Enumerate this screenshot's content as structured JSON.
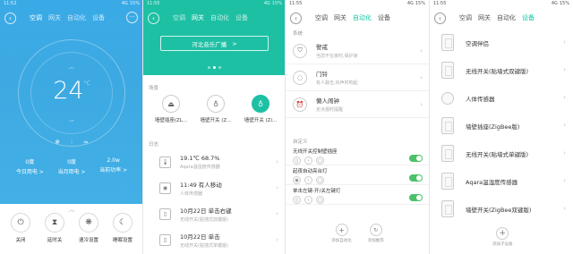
{
  "tabs": [
    "空调",
    "网关",
    "自动化",
    "设备"
  ],
  "status": {
    "p1_time": "11:52",
    "p2_time": "11:55",
    "p3_time": "11:55",
    "p4_time": "11:55",
    "signal": "4G",
    "battery": "15%"
  },
  "ac": {
    "temp": "24",
    "unit": "°C",
    "stats": [
      {
        "value": "0度",
        "label": "今日用电 >"
      },
      {
        "value": "0度",
        "label": "当月用电 >"
      },
      {
        "value": "2.0w",
        "label": "当前功率 >"
      }
    ],
    "controls": [
      {
        "icon": "⏻",
        "label": "关闭"
      },
      {
        "icon": "⧗",
        "label": "延时关"
      },
      {
        "icon": "❋",
        "label": "速冷设置"
      },
      {
        "icon": "☾",
        "label": "睡眠设置"
      }
    ]
  },
  "gateway": {
    "radio": "河北音乐广播",
    "radio_arrow": ">",
    "scene_title": "场景",
    "scenes": [
      "墙壁插座(ZL...",
      "墙壁开关 (Z...",
      "墙壁开关 (Zi..."
    ],
    "log_title": "日志",
    "logs": [
      {
        "main": "19.1℃  68.7%",
        "sub": "Aqara温湿度传感器"
      },
      {
        "main": "11:49  有人移动",
        "sub": "人体传感器"
      },
      {
        "main": "10月22日  单击右键",
        "sub": "无线开关(贴墙式双键版)"
      },
      {
        "main": "10月22日  单击",
        "sub": "无线开关(贴墙式单键版)"
      }
    ]
  },
  "automation": {
    "system_title": "系统",
    "items": [
      {
        "main": "警戒",
        "sub": "当您不在家时,保护家"
      },
      {
        "main": "门铃",
        "sub": "有人敲击,铃声时响起"
      },
      {
        "main": "懒人闹钟",
        "sub": "定点报时提醒"
      }
    ],
    "custom_title": "自定义",
    "custom": [
      {
        "main": "无线开关控制壁插座"
      },
      {
        "main": "起夜自动亮台灯"
      },
      {
        "main": "单击左键-开/关左键灯"
      }
    ],
    "actions": [
      {
        "icon": "+",
        "label": "添加自动化"
      },
      {
        "icon": "↻",
        "label": "添加推荐"
      }
    ]
  },
  "devices": {
    "items": [
      "空调伴侣",
      "无线开关(贴墙式双键版)",
      "人体传感器",
      "墙壁插座(ZigBee版)",
      "无线开关(贴墙式单键版)",
      "Aqara温湿度传感器",
      "墙壁开关(ZigBee双键版)"
    ],
    "add_label": "添加子设备"
  }
}
